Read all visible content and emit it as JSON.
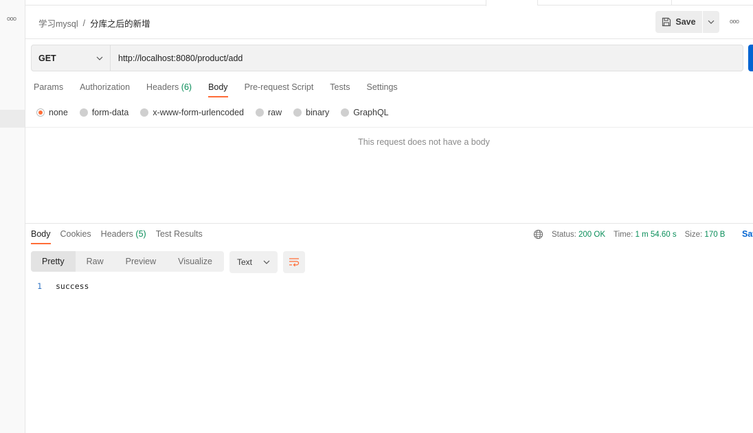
{
  "breadcrumb": {
    "collection": "学习mysql",
    "separator": "/",
    "request": "分库之后的新增"
  },
  "header": {
    "save_label": "Save",
    "more_icon": "ooo"
  },
  "request": {
    "method": "GET",
    "url": "http://localhost:8080/product/add"
  },
  "request_tabs": [
    {
      "label": "Params"
    },
    {
      "label": "Authorization"
    },
    {
      "label": "Headers",
      "count": "(6)"
    },
    {
      "label": "Body",
      "active": true
    },
    {
      "label": "Pre-request Script"
    },
    {
      "label": "Tests"
    },
    {
      "label": "Settings"
    }
  ],
  "body_types": [
    {
      "label": "none",
      "checked": true
    },
    {
      "label": "form-data"
    },
    {
      "label": "x-www-form-urlencoded"
    },
    {
      "label": "raw"
    },
    {
      "label": "binary"
    },
    {
      "label": "GraphQL"
    }
  ],
  "no_body_message": "This request does not have a body",
  "response": {
    "tabs": [
      {
        "label": "Body",
        "active": true
      },
      {
        "label": "Cookies"
      },
      {
        "label": "Headers",
        "count": "(5)"
      },
      {
        "label": "Test Results"
      }
    ],
    "status_label": "Status:",
    "status_value": "200 OK",
    "time_label": "Time:",
    "time_value": "1 m 54.60 s",
    "size_label": "Size:",
    "size_value": "170 B",
    "save_label": "Sav",
    "view_tabs": [
      "Pretty",
      "Raw",
      "Preview",
      "Visualize"
    ],
    "format": "Text",
    "lines": [
      {
        "no": "1",
        "text": "success"
      }
    ]
  },
  "colors": {
    "accent": "#ff6c37",
    "success": "#0a8e5a",
    "link": "#0265d2"
  },
  "icons": {
    "left_more": "ooo",
    "save": "floppy-icon",
    "globe": "globe-icon",
    "wrap": "wrap-lines-icon"
  }
}
